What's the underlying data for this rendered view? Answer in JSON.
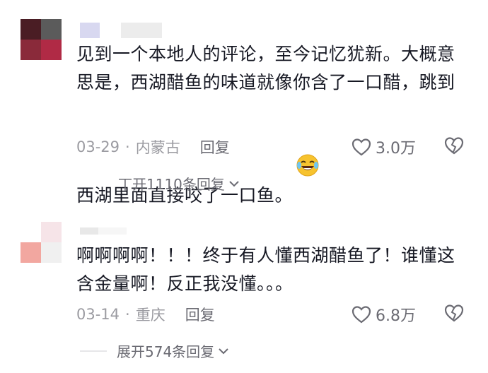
{
  "comments": [
    {
      "text": "见到一个本地人的评论，至今记忆犹新。大概意思是，西湖醋鱼的味道就像你含了一口醋，跳到西湖里面直接咬了一口鱼。",
      "emoji": "laughing-crying-emoji",
      "date": "03-29",
      "dot": "·",
      "location": "内蒙古",
      "reply_label": "回复",
      "likes": "3.0万",
      "expand_label": "开1110条回复",
      "expand_prefix": "丅",
      "avatar_colors": [
        "#4a1d24",
        "#5b5b5b",
        "#8a2a3a",
        "#b02a45"
      ]
    },
    {
      "text": "啊啊啊啊！！！终于有人懂西湖醋鱼了！谁懂这含金量啊！反正我没懂。。。",
      "date": "03-14",
      "dot": "·",
      "location": "重庆",
      "reply_label": "回复",
      "likes": "6.8万",
      "expand_label": "展开574条回复",
      "avatar_colors": [
        "#f6e4e8",
        "#f2f2f2",
        "#f2a7a0",
        "#dcdcdc"
      ]
    }
  ],
  "colors": {
    "text": "#161823",
    "meta": "#9b9ba1",
    "secondary": "#6b6b73"
  }
}
